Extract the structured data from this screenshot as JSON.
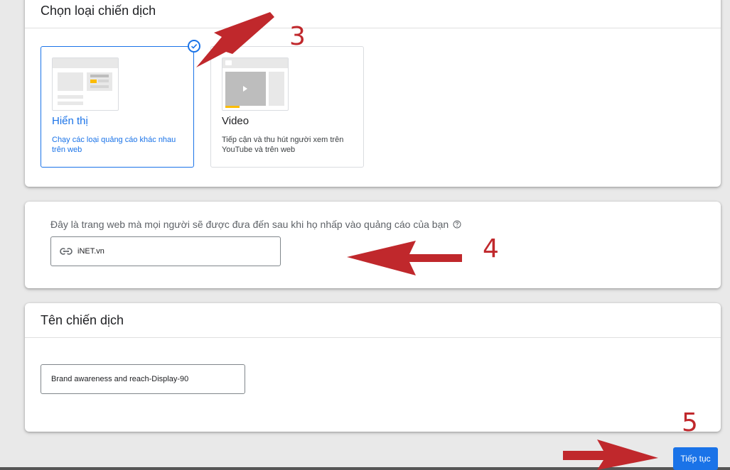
{
  "campaign_type": {
    "title": "Chọn loại chiến dịch",
    "options": [
      {
        "title": "Hiển thị",
        "description": "Chạy các loại quảng cáo khác nhau trên web",
        "selected": true,
        "thumb_icon": "display-ad-preview-icon"
      },
      {
        "title": "Video",
        "description": "Tiếp cận và thu hút người xem trên YouTube và trên web",
        "selected": false,
        "thumb_icon": "video-ad-preview-icon"
      }
    ]
  },
  "website": {
    "label": "Đây là trang web mà mọi người sẽ được đưa đến sau khi họ nhấp vào quảng cáo của bạn",
    "value": "iNET.vn",
    "icon": "link-icon"
  },
  "campaign_name": {
    "title": "Tên chiến dịch",
    "value": "Brand awareness and reach-Display-90"
  },
  "footer": {
    "continue_label": "Tiếp tục"
  },
  "annotations": [
    "3",
    "4",
    "5"
  ],
  "colors": {
    "accent": "#1a73e8",
    "arrow": "#c0282c",
    "highlight": "#fbbc04"
  }
}
